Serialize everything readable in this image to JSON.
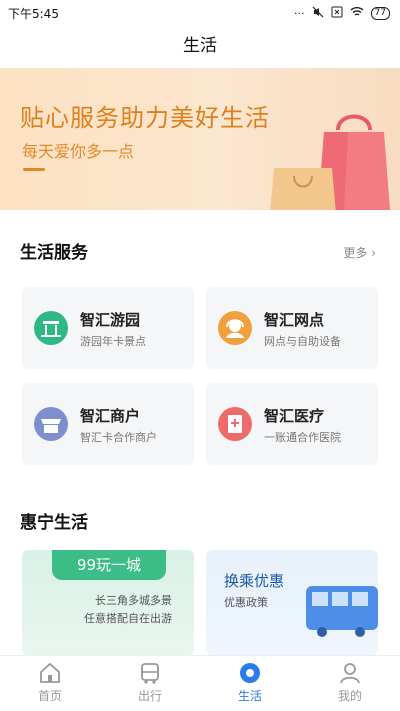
{
  "status_bar": {
    "time": "下午5:45",
    "battery": "77"
  },
  "header": {
    "title": "生活"
  },
  "banner": {
    "title": "贴心服务助力美好生活",
    "subtitle": "每天爱你多一点"
  },
  "services": {
    "title": "生活服务",
    "more_label": "更多 ›",
    "items": [
      {
        "name": "智汇游园",
        "desc": "游园年卡景点",
        "icon": "park-gate-icon",
        "color": "#2eb886"
      },
      {
        "name": "智汇网点",
        "desc": "网点与自助设备",
        "icon": "service-agent-icon",
        "color": "#f1a03b"
      },
      {
        "name": "智汇商户",
        "desc": "智汇卡合作商户",
        "icon": "merchant-store-icon",
        "color": "#7d8fcf"
      },
      {
        "name": "智汇医疗",
        "desc": "一账通合作医院",
        "icon": "hospital-icon",
        "color": "#ef6a6a"
      }
    ]
  },
  "huining": {
    "title": "惠宁生活",
    "left_card": {
      "ribbon": "99玩一城",
      "line1": "长三角多城多景",
      "line2": "任意搭配自在出游"
    },
    "right_card": {
      "title": "换乘优惠",
      "subtitle": "优惠政策"
    }
  },
  "tabs": [
    {
      "label": "首页",
      "icon": "home-icon",
      "active": false
    },
    {
      "label": "出行",
      "icon": "bus-icon",
      "active": false
    },
    {
      "label": "生活",
      "icon": "life-icon",
      "active": true
    },
    {
      "label": "我的",
      "icon": "profile-icon",
      "active": false
    }
  ],
  "colors": {
    "accent": "#2b7de9",
    "banner_orange": "#e07f1d",
    "promo_green": "#3cbd88"
  }
}
